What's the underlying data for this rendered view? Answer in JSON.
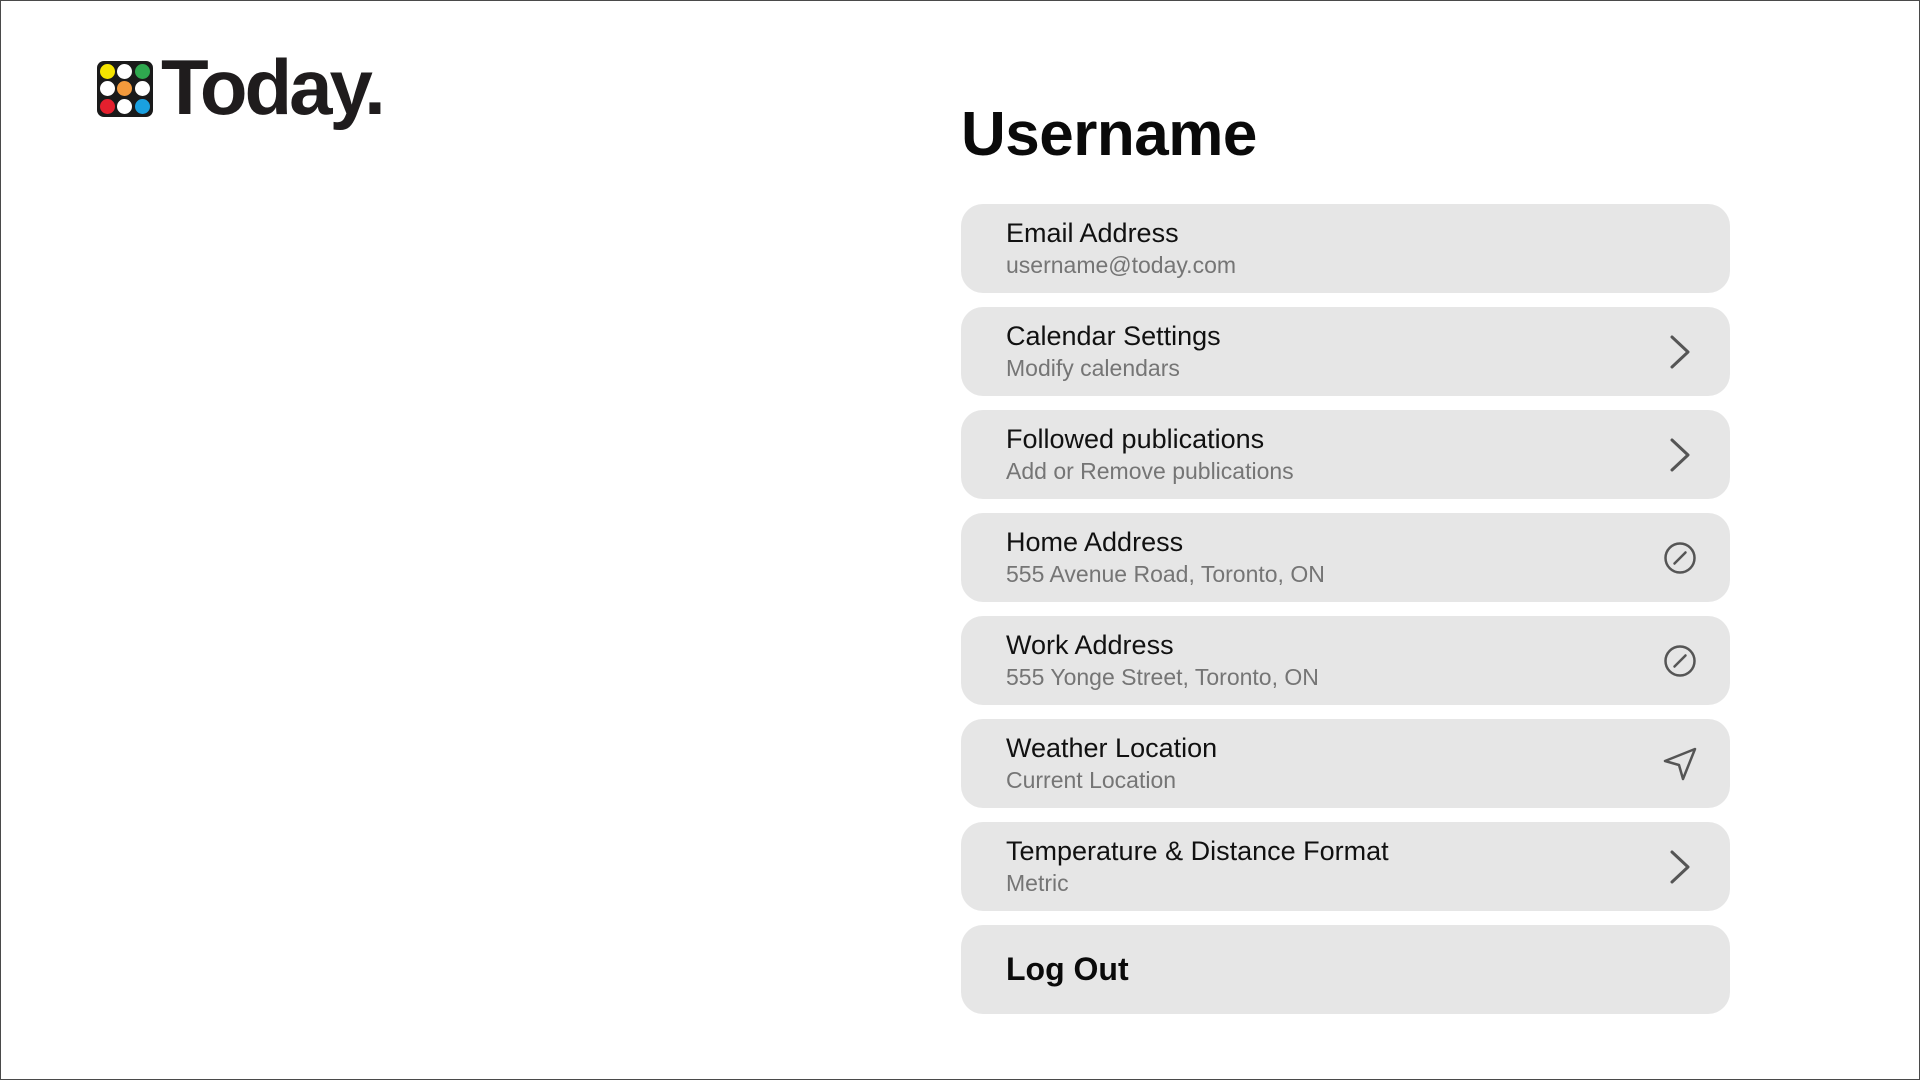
{
  "brand": {
    "name": "Today.",
    "dot_colors": [
      "#f5e400",
      "#ffffff",
      "#2fa84f",
      "#ffffff",
      "#f39a3c",
      "#ffffff",
      "#e5202e",
      "#ffffff",
      "#1aa0e0"
    ]
  },
  "page": {
    "title": "Username"
  },
  "settings": {
    "items": [
      {
        "title": "Email Address",
        "subtitle": "username@today.com",
        "icon": ""
      },
      {
        "title": "Calendar Settings",
        "subtitle": "Modify calendars",
        "icon": "chevron-right-icon"
      },
      {
        "title": "Followed publications",
        "subtitle": "Add or Remove publications",
        "icon": "chevron-right-icon"
      },
      {
        "title": "Home Address",
        "subtitle": "555 Avenue Road, Toronto, ON",
        "icon": "edit-icon"
      },
      {
        "title": "Work Address",
        "subtitle": "555 Yonge Street, Toronto, ON",
        "icon": "edit-icon"
      },
      {
        "title": "Weather Location",
        "subtitle": "Current Location",
        "icon": "location-arrow-icon"
      },
      {
        "title": "Temperature & Distance Format",
        "subtitle": "Metric",
        "icon": "chevron-right-icon"
      }
    ],
    "logout_label": "Log Out"
  },
  "colors": {
    "row_background": "#e6e6e6",
    "subtitle_text": "#757575",
    "icon_stroke": "#555555"
  }
}
